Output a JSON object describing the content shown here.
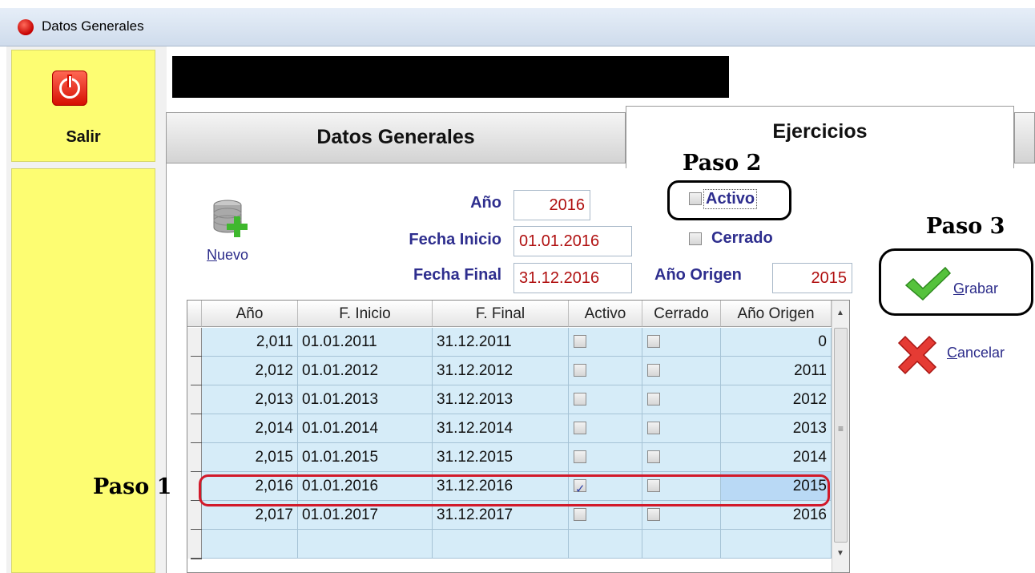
{
  "window": {
    "title": "Datos Generales"
  },
  "sidebar": {
    "salir_label": "Salir"
  },
  "tabs": [
    {
      "label": "Datos Generales",
      "active": false
    },
    {
      "label": "Ejercicios",
      "active": true
    }
  ],
  "annotations": {
    "paso1": "Paso 1",
    "paso2": "Paso 2",
    "paso3": "Paso 3"
  },
  "toolbar": {
    "nuevo_label": "Nuevo",
    "nuevo_hotkey": "N",
    "nuevo_rest": "uevo"
  },
  "form": {
    "anio_label": "Año",
    "anio_value": "2016",
    "fecha_inicio_label": "Fecha Inicio",
    "fecha_inicio_value": "01.01.2016",
    "fecha_final_label": "Fecha Final",
    "fecha_final_value": "31.12.2016",
    "activo_label": "Activo",
    "activo_checked": false,
    "cerrado_label": "Cerrado",
    "cerrado_checked": false,
    "anio_origen_label": "Año Origen",
    "anio_origen_value": "2015"
  },
  "actions": {
    "grabar_hotkey": "G",
    "grabar_rest": "rabar",
    "cancelar_hotkey": "C",
    "cancelar_rest": "ancelar"
  },
  "grid": {
    "columns": [
      "Año",
      "F. Inicio",
      "F. Final",
      "Activo",
      "Cerrado",
      "Año Origen"
    ],
    "rows": [
      {
        "anio": "2,011",
        "inicio": "01.01.2011",
        "final": "31.12.2011",
        "activo": false,
        "cerrado": false,
        "origen": "0"
      },
      {
        "anio": "2,012",
        "inicio": "01.01.2012",
        "final": "31.12.2012",
        "activo": false,
        "cerrado": false,
        "origen": "2011"
      },
      {
        "anio": "2,013",
        "inicio": "01.01.2013",
        "final": "31.12.2013",
        "activo": false,
        "cerrado": false,
        "origen": "2012"
      },
      {
        "anio": "2,014",
        "inicio": "01.01.2014",
        "final": "31.12.2014",
        "activo": false,
        "cerrado": false,
        "origen": "2013"
      },
      {
        "anio": "2,015",
        "inicio": "01.01.2015",
        "final": "31.12.2015",
        "activo": false,
        "cerrado": false,
        "origen": "2014"
      },
      {
        "anio": "2,016",
        "inicio": "01.01.2016",
        "final": "31.12.2016",
        "activo": true,
        "cerrado": false,
        "origen": "2015",
        "selected": true
      },
      {
        "anio": "2,017",
        "inicio": "01.01.2017",
        "final": "31.12.2017",
        "activo": false,
        "cerrado": false,
        "origen": "2016"
      },
      {
        "anio": "",
        "inicio": "",
        "final": "",
        "activo": null,
        "cerrado": null,
        "origen": ""
      }
    ]
  },
  "colors": {
    "row_bg": "#d6ecf8",
    "row_selected_bg": "#b9d9f5",
    "sidebar_yellow": "#fdfd72",
    "annotation_red": "#d21a2a",
    "label_blue": "#2e2e8e",
    "value_red": "#b01010"
  }
}
